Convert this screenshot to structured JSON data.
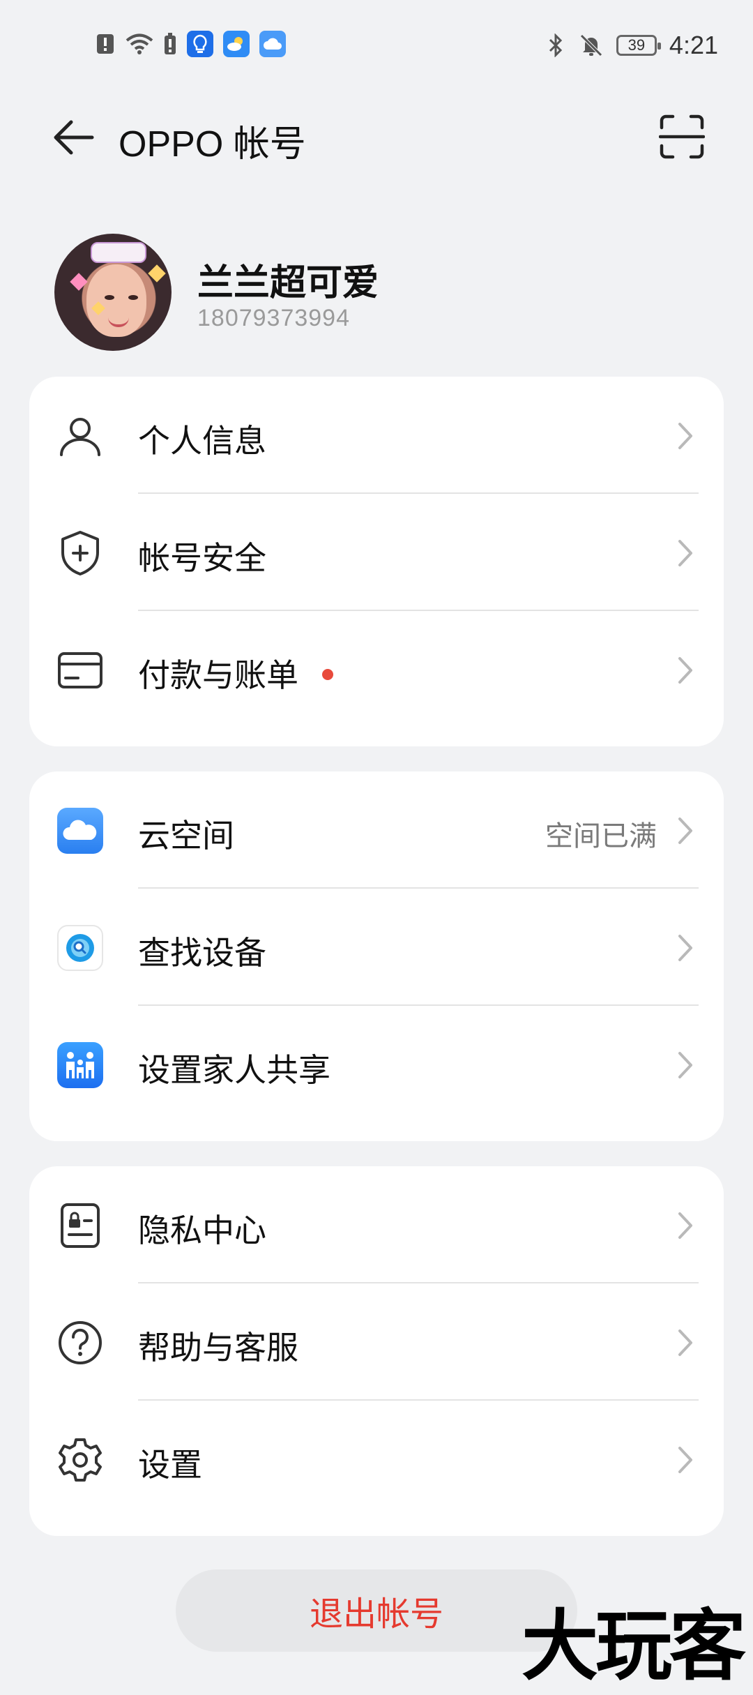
{
  "status_bar": {
    "time": "4:21",
    "battery": "39",
    "icons_left": [
      "alert-icon",
      "wifi-icon",
      "battery-alert-icon",
      "bulb-app-icon",
      "weather-app-icon",
      "cloud-app-icon"
    ],
    "icons_right": [
      "bluetooth-icon",
      "mute-icon"
    ]
  },
  "header": {
    "title": "OPPO 帐号",
    "back_icon": "arrow-left-icon",
    "scan_icon": "scan-icon"
  },
  "profile": {
    "name": "兰兰超可爱",
    "phone": "18079373994"
  },
  "card1": {
    "items": [
      {
        "label": "个人信息",
        "icon": "person-icon"
      },
      {
        "label": "帐号安全",
        "icon": "shield-icon"
      },
      {
        "label": "付款与账单",
        "icon": "card-icon",
        "badge": true
      }
    ]
  },
  "card2": {
    "items": [
      {
        "label": "云空间",
        "icon": "cloud-icon",
        "value": "空间已满"
      },
      {
        "label": "查找设备",
        "icon": "find-device-icon"
      },
      {
        "label": "设置家人共享",
        "icon": "family-icon"
      }
    ]
  },
  "card3": {
    "items": [
      {
        "label": "隐私中心",
        "icon": "privacy-icon"
      },
      {
        "label": "帮助与客服",
        "icon": "help-icon"
      },
      {
        "label": "设置",
        "icon": "gear-icon"
      }
    ]
  },
  "logout_label": "退出帐号",
  "watermark": "大玩客",
  "colors": {
    "background": "#f1f2f4",
    "card": "#ffffff",
    "danger": "#e53a2f",
    "badge": "#e84a3b"
  }
}
